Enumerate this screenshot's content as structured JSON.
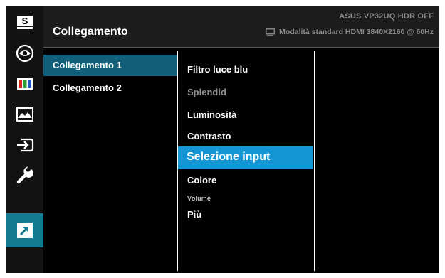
{
  "header": {
    "title": "Collegamento",
    "model_info": "ASUS  VP32UQ  HDR OFF",
    "status_info": "Modalità standard HDMI 3840X2160 @ 60Hz"
  },
  "sidebar": {
    "items": [
      {
        "name": "splendid",
        "icon": "splendid-s-icon",
        "letter": "S",
        "active": false
      },
      {
        "name": "blue-light-filter",
        "icon": "eye-icon",
        "active": false
      },
      {
        "name": "color",
        "icon": "color-bars-icon",
        "active": false
      },
      {
        "name": "image",
        "icon": "mountain-image-icon",
        "active": false
      },
      {
        "name": "input-select",
        "icon": "input-arrow-icon",
        "active": false
      },
      {
        "name": "system-setup",
        "icon": "wrench-icon",
        "active": false
      },
      {
        "name": "shortcut",
        "icon": "shortcut-arrow-icon",
        "active": true
      }
    ]
  },
  "submenu": {
    "items": [
      {
        "label": "Collegamento 1",
        "selected": true
      },
      {
        "label": "Collegamento 2",
        "selected": false
      }
    ]
  },
  "options": {
    "items": [
      {
        "label": "Filtro luce blu",
        "state": "normal"
      },
      {
        "label": "Splendid",
        "state": "disabled"
      },
      {
        "label": "Luminosità",
        "state": "normal"
      },
      {
        "label": "Contrasto",
        "state": "normal"
      },
      {
        "label": "Selezione input",
        "state": "highlighted"
      },
      {
        "label": "Colore",
        "state": "normal"
      },
      {
        "label": "Volume",
        "state": "small"
      },
      {
        "label": "Più",
        "state": "normal"
      }
    ]
  },
  "colors": {
    "active_sidebar": "#137a90",
    "selected_submenu": "#125f79",
    "highlight_option": "#1396d3"
  }
}
